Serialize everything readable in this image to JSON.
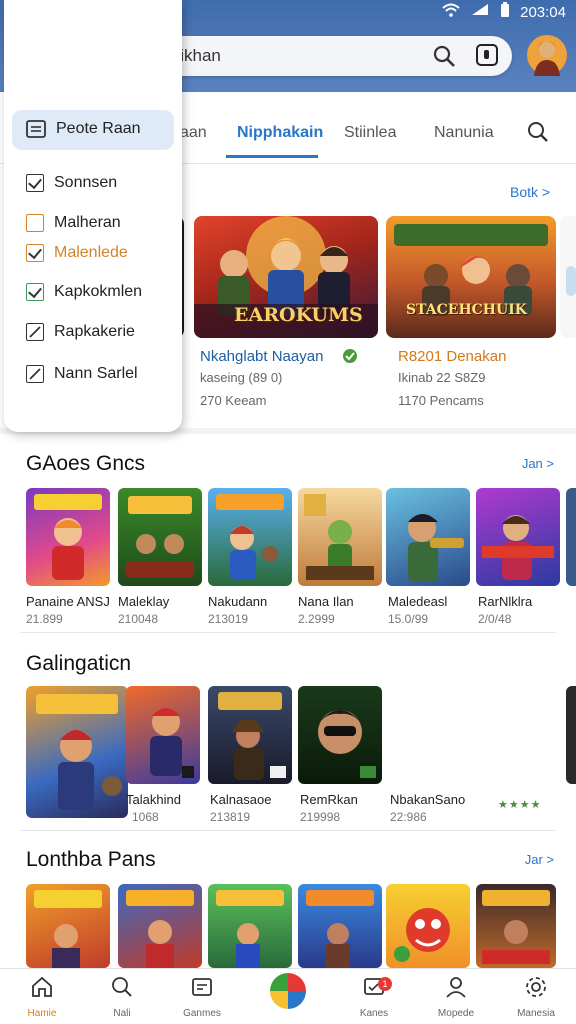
{
  "status": {
    "time": "203:04"
  },
  "search": {
    "query": "Koaikhan"
  },
  "tabs": [
    {
      "label": "aan"
    },
    {
      "label": "Nipphakain"
    },
    {
      "label": "Stiinlea"
    },
    {
      "label": "Nanunia"
    }
  ],
  "drawer": {
    "items": [
      {
        "label": "Peote Raan",
        "color": "#222222"
      },
      {
        "label": "Sonnsen",
        "color": "#222222"
      },
      {
        "label": "Malheran",
        "color": "#222222"
      },
      {
        "label": "Malenlede",
        "color": "#d4832a"
      },
      {
        "label": "Kapkokmlen",
        "color": "#222222"
      },
      {
        "label": "Rapkakerie",
        "color": "#222222"
      },
      {
        "label": "Nann Sarlel",
        "color": "#222222"
      }
    ]
  },
  "featured": {
    "see_all": "Botk >",
    "cards": [
      {
        "art_text": "EAROKUMS",
        "title": "Nkahglabt Naayan",
        "sub1": "kaseing (89 0)",
        "sub2": "270 Keeam"
      },
      {
        "art_text": "STACEHCHUIK",
        "title": "R8201 Denakan",
        "sub1": "Ikinab 22 S8Z9",
        "sub2": "1170 Pencams"
      }
    ]
  },
  "sections": [
    {
      "title": "GAoes Gncs",
      "more": "Jan >",
      "games": [
        {
          "name": "Panaine ANSJ",
          "size": "21.899"
        },
        {
          "name": "Maleklay",
          "size": "210048"
        },
        {
          "name": "Nakudann",
          "size": "213019"
        },
        {
          "name": "Nana Ilan",
          "size": "2.2999"
        },
        {
          "name": "Maledeasl",
          "size": "15.0/99"
        },
        {
          "name": "RarNlklra",
          "size": "2/0/48"
        }
      ]
    },
    {
      "title": "Galingaticn",
      "more": "",
      "games": [
        {
          "name": "Talakhind",
          "size": "1068"
        },
        {
          "name": "Kalnasaoe",
          "size": "213819"
        },
        {
          "name": "RemRkan",
          "size": "219998"
        },
        {
          "name": "NbakanSano",
          "size": "22:986"
        }
      ]
    },
    {
      "title": "Lonthba Pans",
      "more": "Jar >",
      "games": []
    }
  ],
  "bottom_nav": [
    {
      "label": "Hamie"
    },
    {
      "label": "Nali"
    },
    {
      "label": "Ganmes"
    },
    {
      "label": ""
    },
    {
      "label": "Kanes",
      "badge": "1"
    },
    {
      "label": "Mopede"
    },
    {
      "label": "Manesia"
    }
  ],
  "colors": {
    "accent": "#2a76c9",
    "header": "#4a74b4",
    "drawer_highlight": "#dfeaf8"
  }
}
